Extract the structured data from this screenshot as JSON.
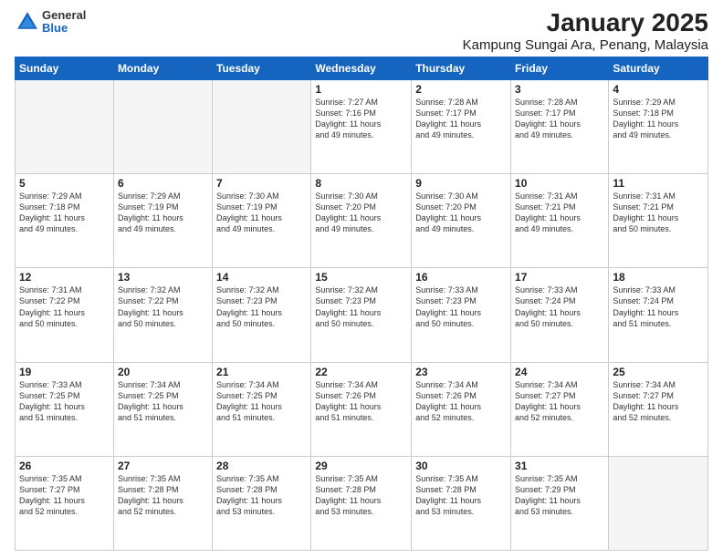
{
  "header": {
    "logo_general": "General",
    "logo_blue": "Blue",
    "title": "January 2025",
    "subtitle": "Kampung Sungai Ara, Penang, Malaysia"
  },
  "weekdays": [
    "Sunday",
    "Monday",
    "Tuesday",
    "Wednesday",
    "Thursday",
    "Friday",
    "Saturday"
  ],
  "weeks": [
    [
      {
        "day": "",
        "info": ""
      },
      {
        "day": "",
        "info": ""
      },
      {
        "day": "",
        "info": ""
      },
      {
        "day": "1",
        "info": "Sunrise: 7:27 AM\nSunset: 7:16 PM\nDaylight: 11 hours\nand 49 minutes."
      },
      {
        "day": "2",
        "info": "Sunrise: 7:28 AM\nSunset: 7:17 PM\nDaylight: 11 hours\nand 49 minutes."
      },
      {
        "day": "3",
        "info": "Sunrise: 7:28 AM\nSunset: 7:17 PM\nDaylight: 11 hours\nand 49 minutes."
      },
      {
        "day": "4",
        "info": "Sunrise: 7:29 AM\nSunset: 7:18 PM\nDaylight: 11 hours\nand 49 minutes."
      }
    ],
    [
      {
        "day": "5",
        "info": "Sunrise: 7:29 AM\nSunset: 7:18 PM\nDaylight: 11 hours\nand 49 minutes."
      },
      {
        "day": "6",
        "info": "Sunrise: 7:29 AM\nSunset: 7:19 PM\nDaylight: 11 hours\nand 49 minutes."
      },
      {
        "day": "7",
        "info": "Sunrise: 7:30 AM\nSunset: 7:19 PM\nDaylight: 11 hours\nand 49 minutes."
      },
      {
        "day": "8",
        "info": "Sunrise: 7:30 AM\nSunset: 7:20 PM\nDaylight: 11 hours\nand 49 minutes."
      },
      {
        "day": "9",
        "info": "Sunrise: 7:30 AM\nSunset: 7:20 PM\nDaylight: 11 hours\nand 49 minutes."
      },
      {
        "day": "10",
        "info": "Sunrise: 7:31 AM\nSunset: 7:21 PM\nDaylight: 11 hours\nand 49 minutes."
      },
      {
        "day": "11",
        "info": "Sunrise: 7:31 AM\nSunset: 7:21 PM\nDaylight: 11 hours\nand 50 minutes."
      }
    ],
    [
      {
        "day": "12",
        "info": "Sunrise: 7:31 AM\nSunset: 7:22 PM\nDaylight: 11 hours\nand 50 minutes."
      },
      {
        "day": "13",
        "info": "Sunrise: 7:32 AM\nSunset: 7:22 PM\nDaylight: 11 hours\nand 50 minutes."
      },
      {
        "day": "14",
        "info": "Sunrise: 7:32 AM\nSunset: 7:23 PM\nDaylight: 11 hours\nand 50 minutes."
      },
      {
        "day": "15",
        "info": "Sunrise: 7:32 AM\nSunset: 7:23 PM\nDaylight: 11 hours\nand 50 minutes."
      },
      {
        "day": "16",
        "info": "Sunrise: 7:33 AM\nSunset: 7:23 PM\nDaylight: 11 hours\nand 50 minutes."
      },
      {
        "day": "17",
        "info": "Sunrise: 7:33 AM\nSunset: 7:24 PM\nDaylight: 11 hours\nand 50 minutes."
      },
      {
        "day": "18",
        "info": "Sunrise: 7:33 AM\nSunset: 7:24 PM\nDaylight: 11 hours\nand 51 minutes."
      }
    ],
    [
      {
        "day": "19",
        "info": "Sunrise: 7:33 AM\nSunset: 7:25 PM\nDaylight: 11 hours\nand 51 minutes."
      },
      {
        "day": "20",
        "info": "Sunrise: 7:34 AM\nSunset: 7:25 PM\nDaylight: 11 hours\nand 51 minutes."
      },
      {
        "day": "21",
        "info": "Sunrise: 7:34 AM\nSunset: 7:25 PM\nDaylight: 11 hours\nand 51 minutes."
      },
      {
        "day": "22",
        "info": "Sunrise: 7:34 AM\nSunset: 7:26 PM\nDaylight: 11 hours\nand 51 minutes."
      },
      {
        "day": "23",
        "info": "Sunrise: 7:34 AM\nSunset: 7:26 PM\nDaylight: 11 hours\nand 52 minutes."
      },
      {
        "day": "24",
        "info": "Sunrise: 7:34 AM\nSunset: 7:27 PM\nDaylight: 11 hours\nand 52 minutes."
      },
      {
        "day": "25",
        "info": "Sunrise: 7:34 AM\nSunset: 7:27 PM\nDaylight: 11 hours\nand 52 minutes."
      }
    ],
    [
      {
        "day": "26",
        "info": "Sunrise: 7:35 AM\nSunset: 7:27 PM\nDaylight: 11 hours\nand 52 minutes."
      },
      {
        "day": "27",
        "info": "Sunrise: 7:35 AM\nSunset: 7:28 PM\nDaylight: 11 hours\nand 52 minutes."
      },
      {
        "day": "28",
        "info": "Sunrise: 7:35 AM\nSunset: 7:28 PM\nDaylight: 11 hours\nand 53 minutes."
      },
      {
        "day": "29",
        "info": "Sunrise: 7:35 AM\nSunset: 7:28 PM\nDaylight: 11 hours\nand 53 minutes."
      },
      {
        "day": "30",
        "info": "Sunrise: 7:35 AM\nSunset: 7:28 PM\nDaylight: 11 hours\nand 53 minutes."
      },
      {
        "day": "31",
        "info": "Sunrise: 7:35 AM\nSunset: 7:29 PM\nDaylight: 11 hours\nand 53 minutes."
      },
      {
        "day": "",
        "info": ""
      }
    ]
  ]
}
